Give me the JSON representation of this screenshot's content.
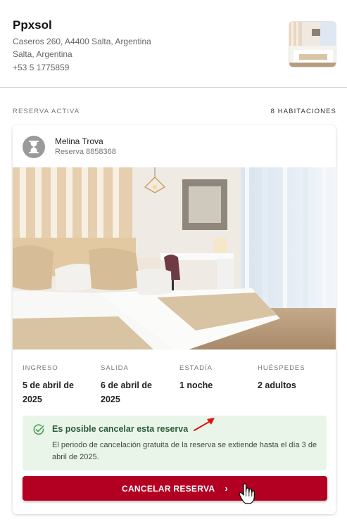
{
  "hotel": {
    "name": "Ppxsol",
    "address_line1": "Caseros 260, A4400 Salta, Argentina",
    "address_line2": "Salta, Argentina",
    "phone": "+53 5 1775859"
  },
  "section": {
    "left_label": "RESERVA ACTIVA",
    "right_label": "8 HABITACIONES"
  },
  "guest": {
    "name": "Melina Trova",
    "reservation": "Reserva 8858368"
  },
  "stay": [
    {
      "label": "INGRESO",
      "value": "5 de abril de 2025"
    },
    {
      "label": "SALIDA",
      "value": "6 de abril de 2025"
    },
    {
      "label": "ESTADÍA",
      "value": "1 noche"
    },
    {
      "label": "HUÉSPEDES",
      "value": "2 adultos"
    }
  ],
  "notice": {
    "title": "Es posible cancelar esta reserva",
    "text": "El periodo de cancelación gratuita de la reserva se extiende hasta el día 3 de abril de 2025."
  },
  "cancel_button": {
    "label": "CANCELAR RESERVA",
    "chevron": "›"
  },
  "colors": {
    "accent": "#b30022",
    "notice_bg": "#eaf5ea",
    "notice_title": "#2b5d36",
    "annotation_arrow": "#e01010"
  },
  "icons": [
    "hourglass-icon",
    "check-circle-icon",
    "chevron-right-icon",
    "hand-cursor-icon",
    "annotation-arrow-icon"
  ]
}
